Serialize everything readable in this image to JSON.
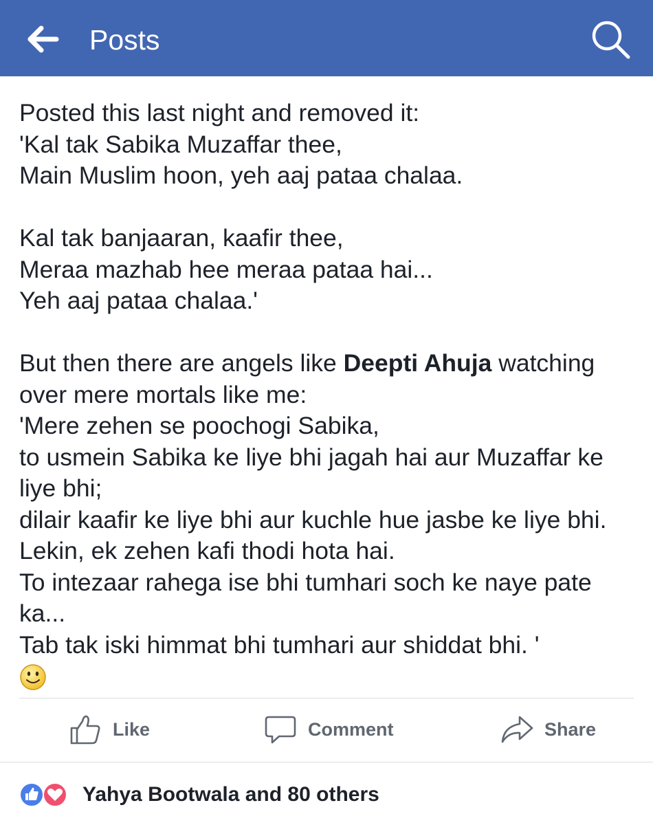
{
  "header": {
    "title": "Posts",
    "back_icon": "arrow-left-icon",
    "search_icon": "search-icon",
    "background_color": "#4267b2"
  },
  "post": {
    "lines_part1": [
      "Posted this last night and removed it:",
      "'Kal tak Sabika Muzaffar thee,",
      "Main Muslim hoon, yeh aaj pataa chalaa."
    ],
    "lines_part2": [
      "Kal tak banjaaran, kaafir thee,",
      "Meraa mazhab hee meraa pataa hai...",
      "Yeh aaj pataa chalaa.'"
    ],
    "mention_line": {
      "before": "But then there are angels like ",
      "mention": "Deepti Ahuja",
      "after": " watching"
    },
    "lines_part3": [
      "over mere mortals like me:",
      "'Mere zehen se poochogi Sabika,",
      "to usmein Sabika ke liye bhi jagah hai aur Muzaffar ke",
      "liye bhi;",
      "dilair kaafir ke liye bhi aur kuchle hue jasbe ke liye bhi.",
      "Lekin, ek zehen kafi thodi hota hai.",
      "To intezaar rahega ise bhi tumhari soch ke naye pate",
      "ka...",
      "Tab tak iski himmat bhi tumhari aur shiddat bhi. '"
    ],
    "emoji": "smiley-emoji-icon"
  },
  "actions": {
    "like_label": "Like",
    "comment_label": "Comment",
    "share_label": "Share",
    "like_icon": "thumbs-up-icon",
    "comment_icon": "comment-bubble-icon",
    "share_icon": "share-arrow-icon"
  },
  "reactions": {
    "text": "Yahya Bootwala and 80 others",
    "like_icon": "like-reaction-icon",
    "love_icon": "love-reaction-icon"
  }
}
